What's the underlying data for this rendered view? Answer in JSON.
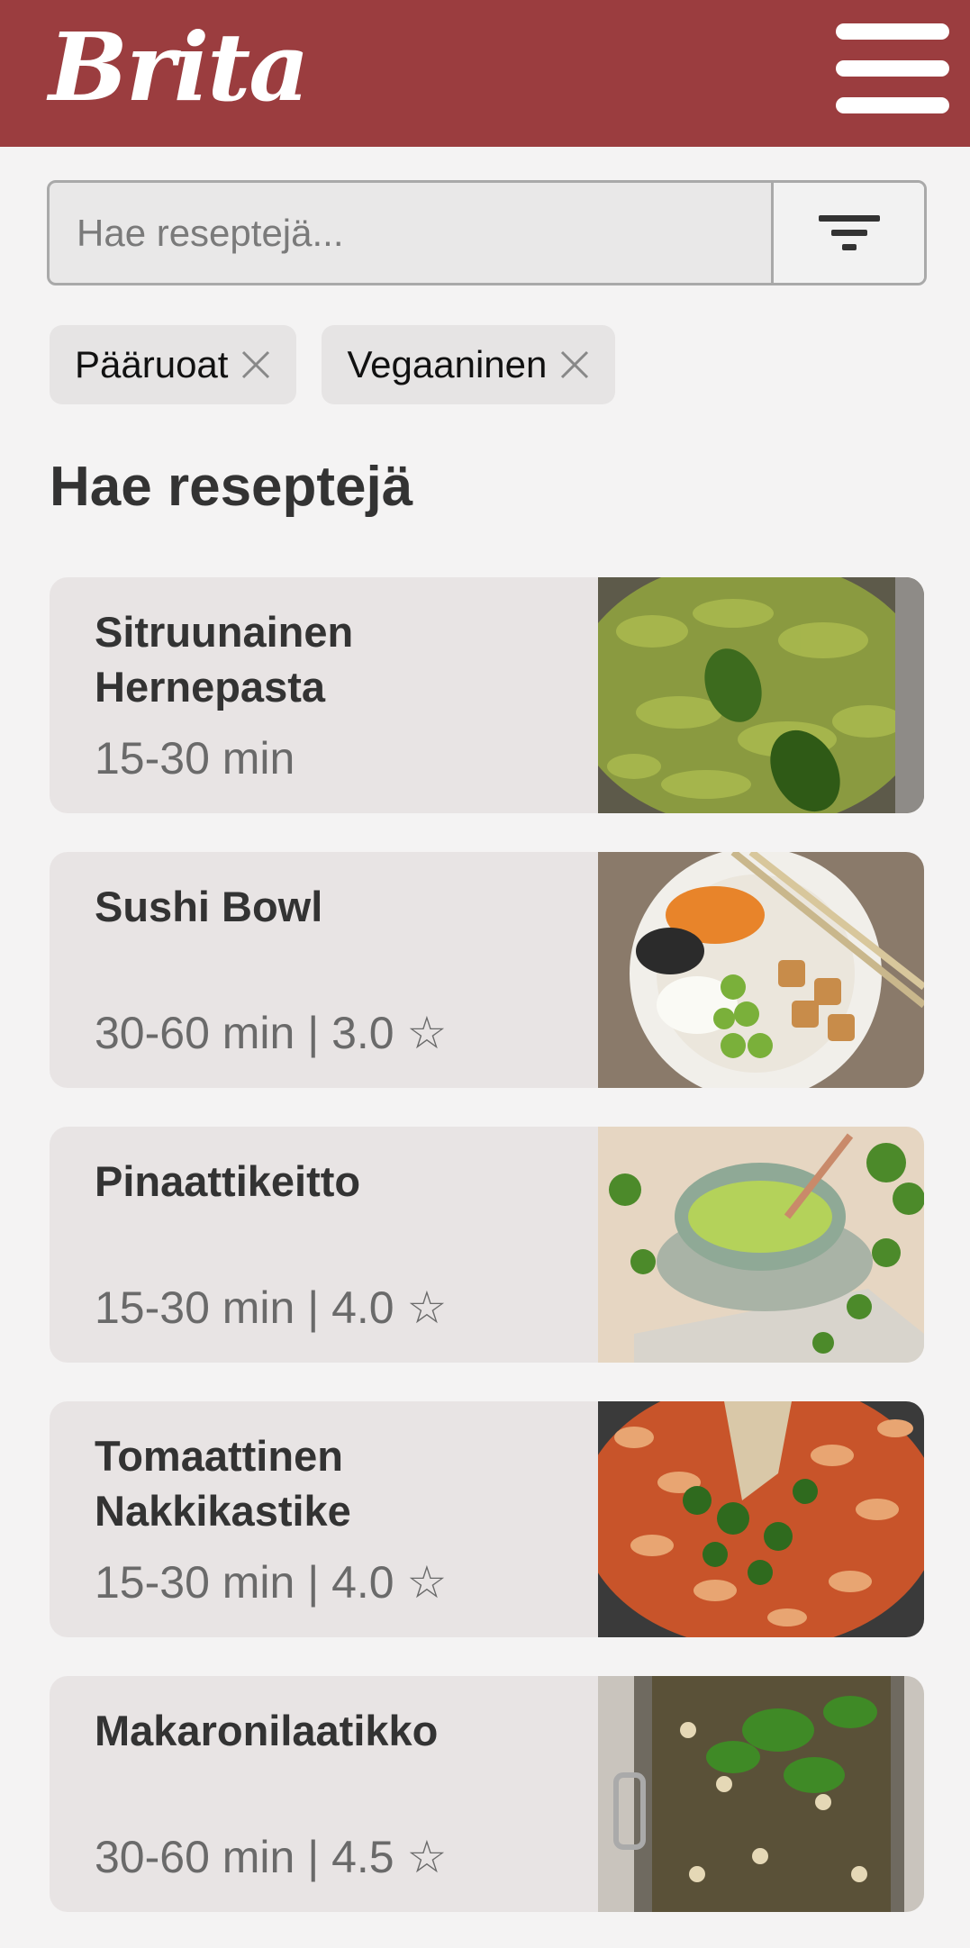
{
  "header": {
    "logo": "Brita",
    "menu_icon": "hamburger-menu-icon"
  },
  "search": {
    "placeholder": "Hae reseptejä...",
    "value": "",
    "filter_icon": "filter-icon"
  },
  "filters": [
    {
      "label": "Pääruoat"
    },
    {
      "label": "Vegaaninen"
    }
  ],
  "section_title": "Hae reseptejä",
  "recipes": [
    {
      "title": "Sitruunainen Hernepasta",
      "meta": "15-30 min"
    },
    {
      "title": "Sushi Bowl",
      "meta": "30-60 min | 3.0 ☆"
    },
    {
      "title": "Pinaattikeitto",
      "meta": "15-30 min | 4.0 ☆"
    },
    {
      "title": "Tomaattinen Nakkikastike",
      "meta": "15-30 min | 4.0 ☆"
    },
    {
      "title": "Makaronilaatikko",
      "meta": "30-60 min | 4.5 ☆"
    }
  ],
  "colors": {
    "brand": "#9b3d3f",
    "card": "#e8e4e4",
    "background": "#f4f3f3"
  }
}
